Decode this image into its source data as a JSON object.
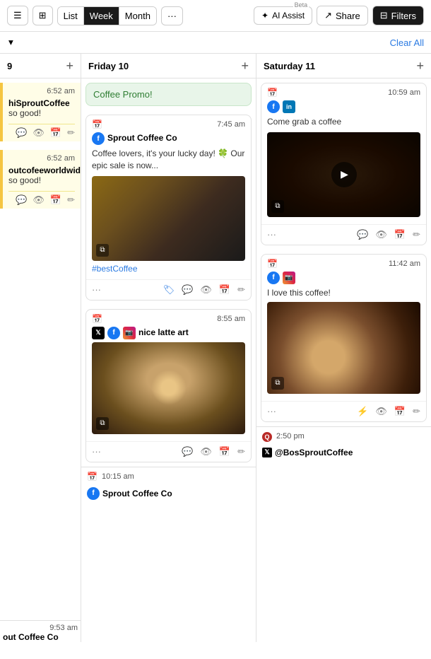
{
  "toolbar": {
    "menu_icon": "≡",
    "layout_icon": "⊞",
    "list_label": "List",
    "week_label": "Week",
    "month_label": "Month",
    "more_label": "···",
    "ai_label": "AI Assist",
    "beta_label": "Beta",
    "share_label": "Share",
    "filters_label": "Filters"
  },
  "subtoolbar": {
    "collapse_icon": "▾",
    "clear_all_label": "Clear All"
  },
  "columns": [
    {
      "id": "col-prev",
      "title": "9",
      "partial": true,
      "cards": [
        {
          "time": "6:52 am",
          "account": "hiSproutCoffee",
          "text": "so good!",
          "yellow_border": true,
          "footer_icons": [
            "comment",
            "eye",
            "calendar",
            "edit"
          ]
        },
        {
          "time": "6:52 am",
          "account": "outcofeeworldwide",
          "text": "so good!",
          "yellow_border": true,
          "footer_icons": [
            "comment",
            "eye",
            "calendar",
            "edit"
          ]
        }
      ]
    },
    {
      "id": "col-fri",
      "title": "Friday 10",
      "cards": [
        {
          "type": "promo",
          "label": "Coffee Promo!"
        },
        {
          "time": "7:45 am",
          "social": [
            "facebook"
          ],
          "account": "Sprout Coffee Co",
          "text": "Coffee lovers, it's your lucky day! 🍀 Our epic sale is now...",
          "has_image": true,
          "image_type": "coffee1",
          "hashtag": "#bestCoffee",
          "has_multi": true,
          "footer_icons": [
            "more",
            "tag",
            "comment",
            "eye",
            "calendar",
            "edit"
          ]
        },
        {
          "time": "8:55 am",
          "social": [
            "twitter",
            "facebook",
            "instagram"
          ],
          "account": "nice latte art",
          "text": "",
          "has_image": true,
          "image_type": "latte",
          "has_multi": true,
          "footer_icons": [
            "more",
            "comment",
            "eye",
            "calendar",
            "edit"
          ]
        }
      ]
    },
    {
      "id": "col-sat",
      "title": "Saturday 11",
      "cards": [
        {
          "time": "10:59 am",
          "social": [
            "facebook",
            "linkedin"
          ],
          "account": "",
          "text": "Come grab a coffee",
          "has_image": true,
          "image_type": "video",
          "has_play": true,
          "has_multi": true,
          "footer_icons": [
            "more",
            "comment",
            "eye",
            "calendar",
            "edit"
          ]
        },
        {
          "time": "11:42 am",
          "social": [
            "facebook",
            "instagram"
          ],
          "account": "",
          "text": "I love this coffee!",
          "has_image": true,
          "image_type": "coffee2",
          "has_multi": true,
          "footer_icons": [
            "more",
            "bolt",
            "eye",
            "calendar",
            "edit"
          ]
        }
      ]
    }
  ],
  "bottom_cards": [
    {
      "col": "fri",
      "time": "10:15 am",
      "social": [
        "facebook"
      ],
      "account": "Sprout Coffee Co"
    },
    {
      "col": "sat",
      "time": "2:50 pm",
      "social": [
        "quora"
      ],
      "account": "@BosSproutCoffee"
    }
  ],
  "prev_bottom": {
    "time": "9:53 am",
    "account": "out Coffee Co"
  }
}
